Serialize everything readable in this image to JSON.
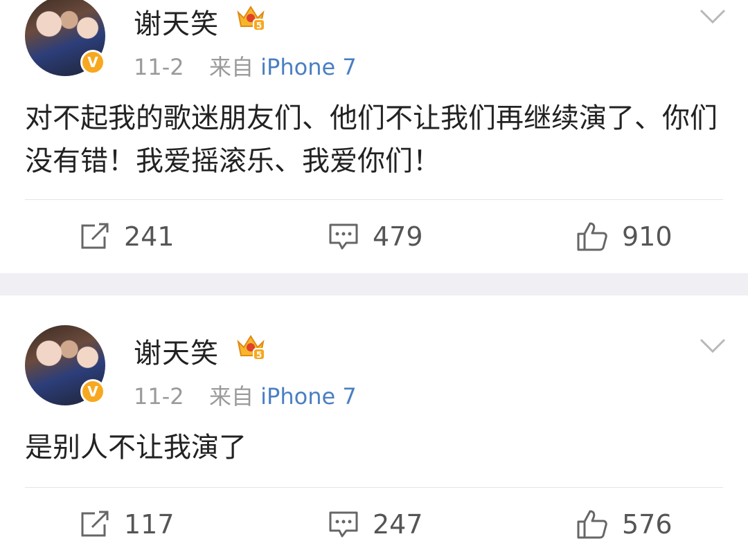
{
  "posts": [
    {
      "author": "谢天笑",
      "verified_badge": "V",
      "member_level": "5",
      "date": "11-2",
      "source_prefix": "来自",
      "source_device": "iPhone 7",
      "content": "对不起我的歌迷朋友们、他们不让我们再继续演了、你们没有错！我爱摇滚乐、我爱你们！",
      "reposts": "241",
      "comments": "479",
      "likes": "910"
    },
    {
      "author": "谢天笑",
      "verified_badge": "V",
      "member_level": "5",
      "date": "11-2",
      "source_prefix": "来自",
      "source_device": "iPhone 7",
      "content": "是别人不让我演了",
      "reposts": "117",
      "comments": "247",
      "likes": "576"
    }
  ],
  "colors": {
    "link_blue": "#4a7fc2",
    "meta_gray": "#9a9a9a",
    "verify_gold": "#f7a81f",
    "separator": "#efeff4"
  },
  "icons": {
    "repost": "repost-icon",
    "comment": "comment-icon",
    "like": "thumbs-up-icon",
    "crown": "member-crown-icon",
    "chevron": "chevron-down-icon"
  }
}
